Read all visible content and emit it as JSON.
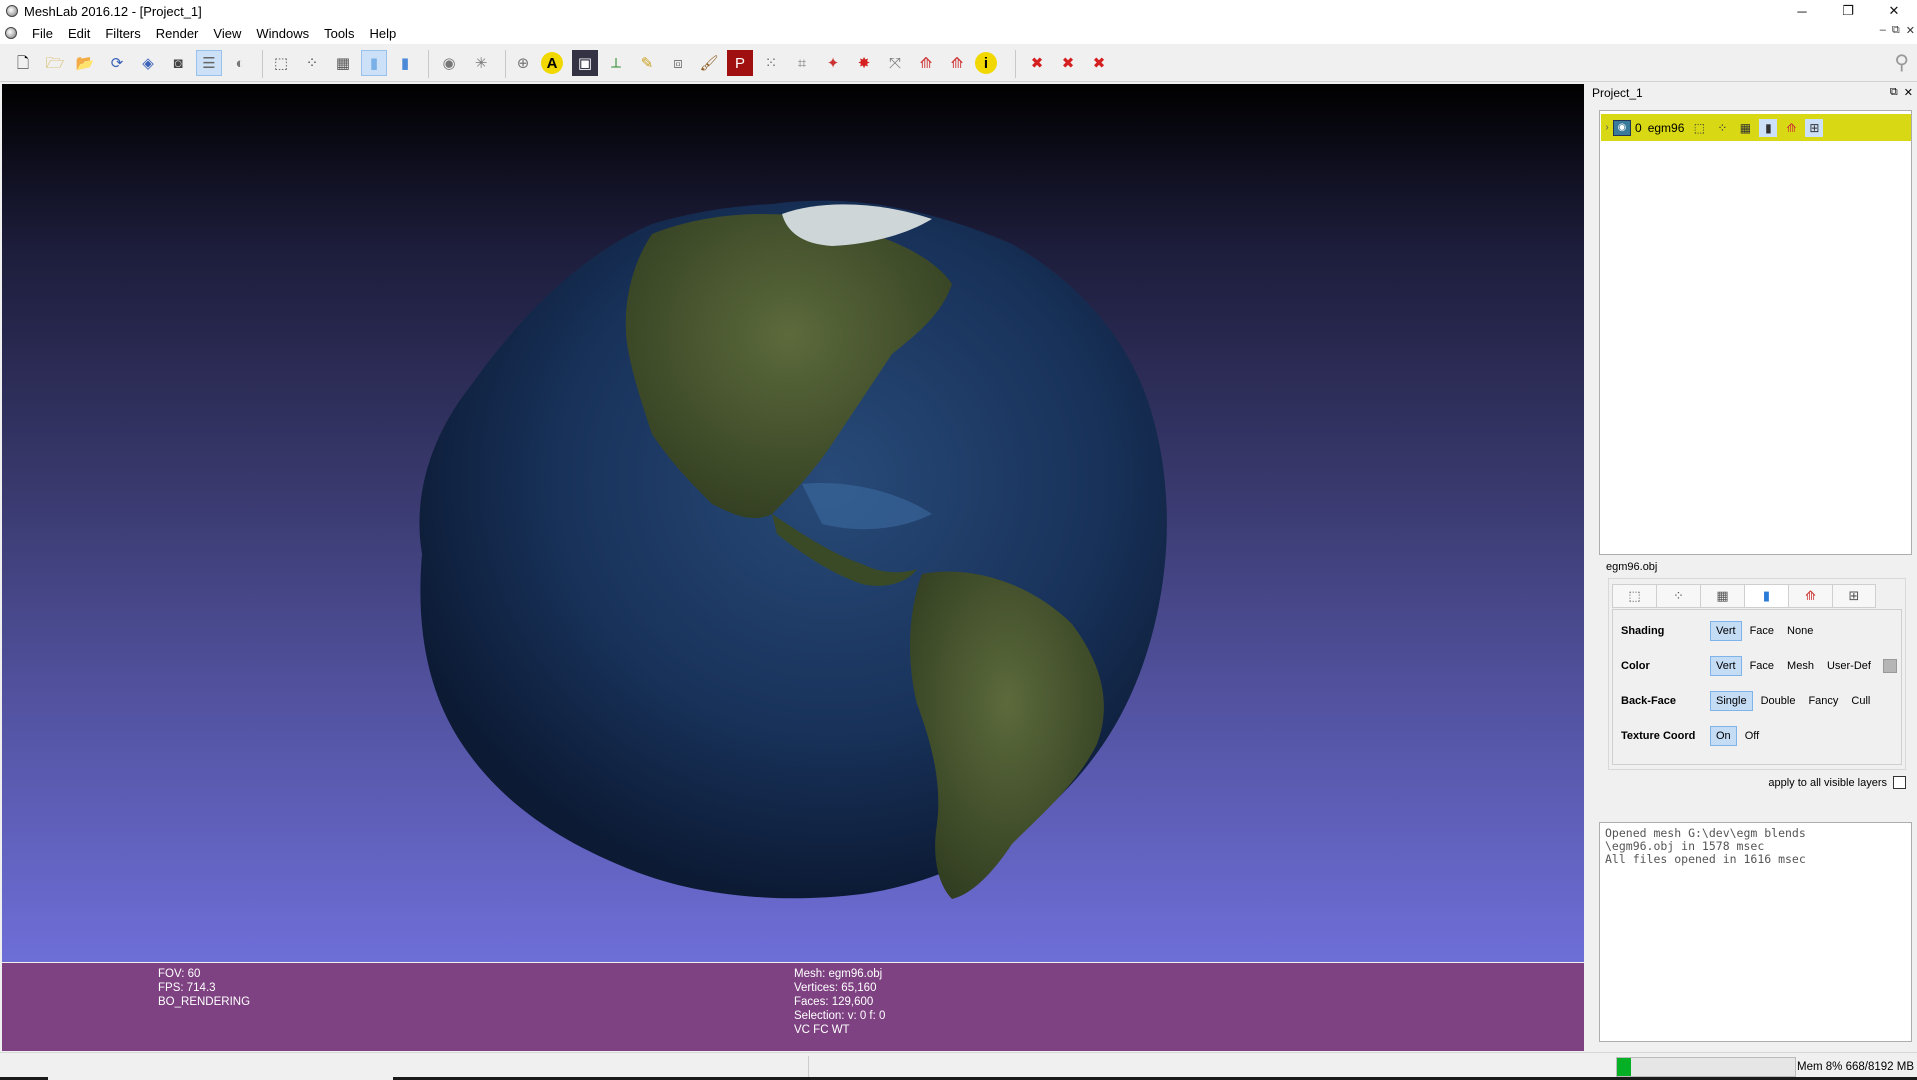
{
  "window": {
    "title": "MeshLab 2016.12 - [Project_1]",
    "controls": {
      "minimize": "─",
      "restore": "❐",
      "close": "✕"
    }
  },
  "menu": [
    "File",
    "Edit",
    "Filters",
    "Render",
    "View",
    "Windows",
    "Tools",
    "Help"
  ],
  "mdi_controls": {
    "minimize": "–",
    "restore": "⧉",
    "close": "✕"
  },
  "toolbar_icons": [
    "new-project-icon",
    "open-project-icon",
    "import-mesh-icon",
    "reload-icon",
    "save-icon",
    "snapshot-icon",
    "layer-dialog-icon",
    "raster-icon",
    "bbox-icon",
    "points-icon",
    "wireframe-icon",
    "flat-shading-icon",
    "smooth-shading-icon",
    "lighting-icon",
    "fancy-lighting-icon",
    "manipulator-icon",
    "annotation-icon",
    "camera-icon",
    "measure-icon",
    "pick-point-icon",
    "align-icon",
    "paint-icon",
    "texture-paint-icon",
    "select-vertex-icon",
    "select-face-icon",
    "color-icon",
    "georef-icon",
    "select-connected-icon",
    "quality-icon",
    "mutual-info-icon",
    "info-icon",
    "delete-icon",
    "delete-faces-icon",
    "delete-vertices-icon"
  ],
  "viewport": {
    "left_info": [
      "FOV: 60",
      "FPS:  714.3",
      "BO_RENDERING"
    ],
    "right_info": [
      "Mesh: egm96.obj",
      "Vertices: 65,160",
      "Faces: 129,600",
      "Selection: v: 0 f: 0",
      "VC FC WT"
    ],
    "colors": {
      "bg_top": "#000000",
      "bg_bottom": "#6e6ed8",
      "infobar": "#7e4282"
    }
  },
  "project_panel": {
    "title": "Project_1",
    "layer": {
      "index": "0",
      "name": "egm96"
    },
    "highlight_color": "#d8d814"
  },
  "render_panel": {
    "mesh_file": "egm96.obj",
    "rows": [
      {
        "label": "Shading",
        "options": [
          "Vert",
          "Face",
          "None"
        ],
        "selected": "Vert"
      },
      {
        "label": "Color",
        "options": [
          "Vert",
          "Face",
          "Mesh",
          "User-Def"
        ],
        "selected": "Vert"
      },
      {
        "label": "Back-Face",
        "options": [
          "Single",
          "Double",
          "Fancy",
          "Cull"
        ],
        "selected": "Single"
      },
      {
        "label": "Texture Coord",
        "options": [
          "On",
          "Off"
        ],
        "selected": "On"
      }
    ],
    "apply_all": "apply to all visible layers"
  },
  "log": {
    "lines": [
      "Opened mesh G:\\dev\\egm blends",
      "\\egm96.obj in 1578 msec",
      "All files opened in 1616 msec"
    ]
  },
  "status": {
    "memory": "Mem 8% 668/8192 MB",
    "memory_fraction": 0.08
  }
}
